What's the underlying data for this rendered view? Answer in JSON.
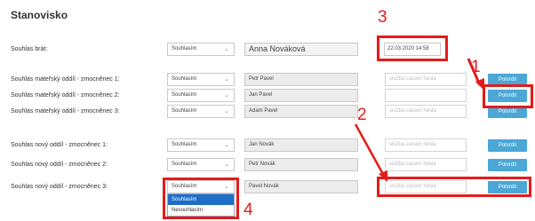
{
  "page": {
    "title": "Stanovisko"
  },
  "rows": [
    {
      "label": "Souhlas brát:",
      "select": "Souhlasím",
      "name": "Anna Nováková",
      "timestamp": "22.03.2020 14:58"
    },
    {
      "label": "Souhlas mateřský oddíl - zmocněnec 1:",
      "select": "Souhlasím",
      "name": "Petr Pavel",
      "note_placeholder": "služba zasaní hesla",
      "button": "Potvrdit"
    },
    {
      "label": "Souhlas mateřský oddíl - zmocněnec 2:",
      "select": "Souhlasím",
      "name": "Jan Pavel",
      "note_placeholder": "",
      "button": "Potvrdit"
    },
    {
      "label": "Souhlas mateřský oddíl - zmocněnec 3:",
      "select": "Souhlasím",
      "name": "Adam Pavel",
      "note_placeholder": "služba zasaní hesla",
      "button": "Potvrdit"
    },
    {
      "label": "Souhlas nový oddíl - zmocněnec 1:",
      "select": "Souhlasím",
      "name": "Jan Novák",
      "note_placeholder": "služba zasaní hesla",
      "button": "Potvrdit"
    },
    {
      "label": "Souhlas nový oddíl - zmocněnec 2:",
      "select": "Souhlasím",
      "name": "Petr Novák",
      "note_placeholder": "služba zasaní hesla",
      "button": "Potvrdit"
    },
    {
      "label": "Souhlas nový oddíl - zmocněnec 3:",
      "select": "Souhlasím",
      "name": "Pavel Novák",
      "note_placeholder": "služba zasaní hesla",
      "button": "Potvrdit"
    }
  ],
  "dropdown_options": [
    "Souhlasím",
    "Nesouhlasím"
  ],
  "annotations": {
    "m1": "1",
    "m2": "2",
    "m3": "3",
    "m4": "4"
  },
  "colors": {
    "accent": "#4aa7d6",
    "annotation": "#e41b1b",
    "selected": "#1e6ec8"
  }
}
